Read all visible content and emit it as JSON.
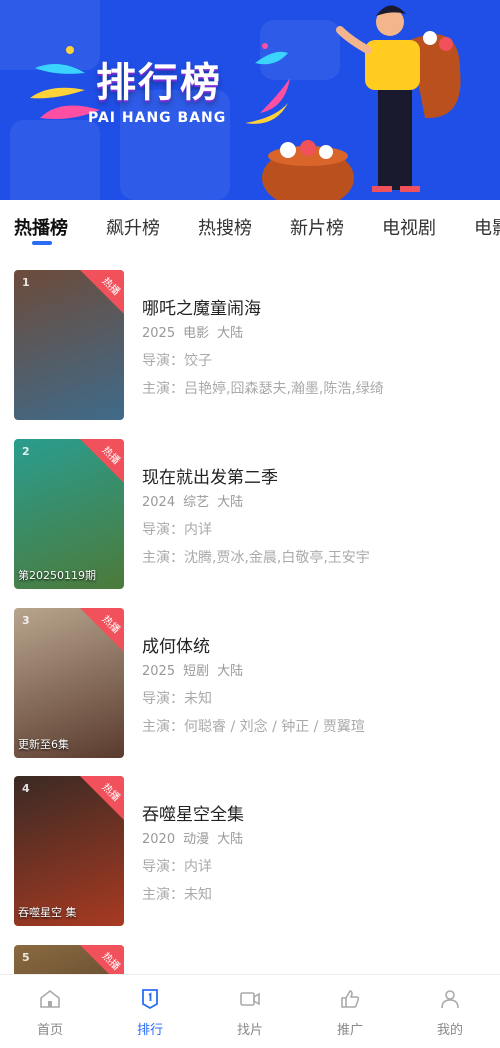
{
  "banner": {
    "title": "排行榜",
    "subtitle": "PAI HANG BANG"
  },
  "tabs": [
    {
      "label": "热播榜",
      "active": true
    },
    {
      "label": "飙升榜",
      "active": false
    },
    {
      "label": "热搜榜",
      "active": false
    },
    {
      "label": "新片榜",
      "active": false
    },
    {
      "label": "电视剧",
      "active": false
    },
    {
      "label": "电影",
      "active": false
    }
  ],
  "list": {
    "hot_label": "热播",
    "director_prefix": "导演：",
    "actors_prefix": "主演：",
    "items": [
      {
        "rank": "1",
        "title": "哪吒之魔童闹海",
        "year": "2025",
        "type": "电影",
        "region": "大陆",
        "director": "饺子",
        "actors": "吕艳婷,囧森瑟夫,瀚墨,陈浩,绿绮",
        "poster_caption": "",
        "poster_colors": [
          "#6d4b3a",
          "#3f6b8a"
        ]
      },
      {
        "rank": "2",
        "title": "现在就出发第二季",
        "year": "2024",
        "type": "综艺",
        "region": "大陆",
        "director": "内详",
        "actors": "沈腾,贾冰,金晨,白敬亭,王安宇",
        "poster_caption": "第20250119期",
        "poster_colors": [
          "#2a9d8f",
          "#4c7a3a"
        ]
      },
      {
        "rank": "3",
        "title": "成何体统",
        "year": "2025",
        "type": "短剧",
        "region": "大陆",
        "director": "未知",
        "actors": "何聪睿 / 刘念 / 钟正 / 贾翼瑄",
        "poster_caption": "更新至6集",
        "poster_colors": [
          "#b8a58e",
          "#5a3b2e"
        ]
      },
      {
        "rank": "4",
        "title": "吞噬星空全集",
        "year": "2020",
        "type": "动漫",
        "region": "大陆",
        "director": "内详",
        "actors": "未知",
        "poster_caption": "吞噬星空 集",
        "poster_colors": [
          "#3a2a24",
          "#a83a22"
        ]
      },
      {
        "rank": "5",
        "title": "",
        "year": "",
        "type": "",
        "region": "",
        "director": "",
        "actors": "",
        "poster_caption": "",
        "poster_colors": [
          "#8a6a40",
          "#3a2a1e"
        ]
      }
    ]
  },
  "bottom_nav": [
    {
      "label": "首页",
      "icon": "home-icon",
      "active": false
    },
    {
      "label": "排行",
      "icon": "rank-icon",
      "active": true
    },
    {
      "label": "找片",
      "icon": "video-search-icon",
      "active": false
    },
    {
      "label": "推广",
      "icon": "thumbs-up-icon",
      "active": false
    },
    {
      "label": "我的",
      "icon": "user-icon",
      "active": false
    }
  ],
  "colors": {
    "accent": "#2a6df4",
    "banner_bg": "#1f4fe6",
    "hot_badge": "#f0515b"
  }
}
